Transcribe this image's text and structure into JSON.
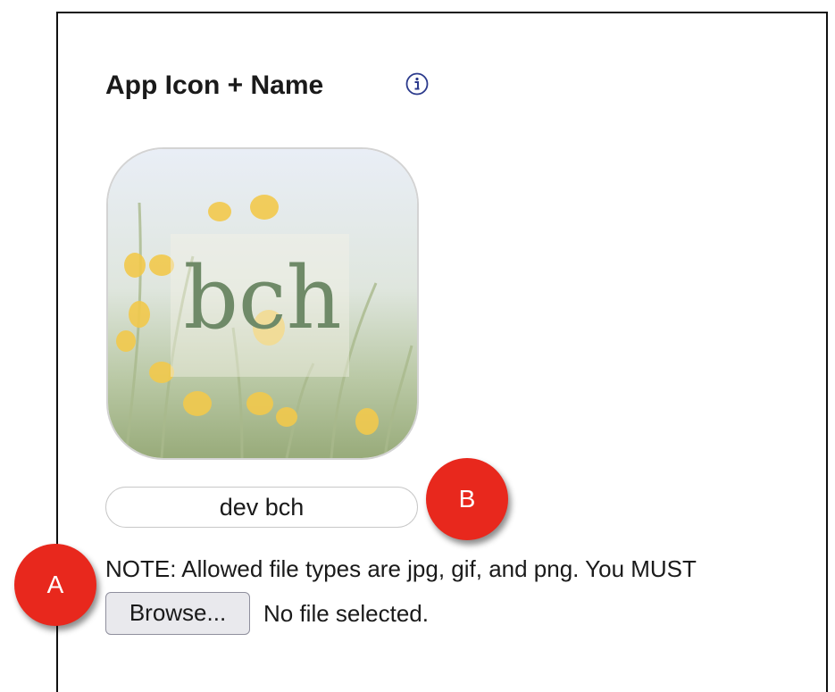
{
  "section": {
    "title": "App Icon + Name",
    "info_icon": "info-circle-icon"
  },
  "app_icon": {
    "text": "bch",
    "accent": "#f2c94c",
    "text_color": "#6f8a68"
  },
  "app_name": {
    "value": "dev bch"
  },
  "note": {
    "text": "NOTE: Allowed file types are jpg, gif, and png. You MUST"
  },
  "file_input": {
    "button_label": "Browse...",
    "status": "No file selected."
  },
  "annotations": {
    "marker_a": "A",
    "marker_b": "B",
    "color": "#e8281d"
  }
}
